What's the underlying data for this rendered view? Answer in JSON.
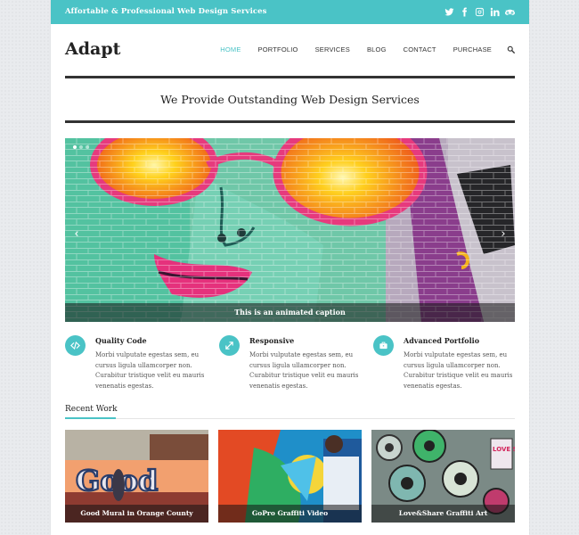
{
  "topbar": {
    "tagline": "Affortable & Professional Web Design Services",
    "social_icons": [
      "twitter-icon",
      "facebook-icon",
      "instagram-icon",
      "linkedin-icon",
      "tripadvisor-icon"
    ]
  },
  "header": {
    "logo": "Adapt",
    "nav": [
      {
        "label": "HOME",
        "active": true
      },
      {
        "label": "PORTFOLIO",
        "active": false
      },
      {
        "label": "SERVICES",
        "active": false
      },
      {
        "label": "BLOG",
        "active": false
      },
      {
        "label": "CONTACT",
        "active": false
      },
      {
        "label": "PURCHASE",
        "active": false
      }
    ],
    "search_icon": "search-icon"
  },
  "headline": "We Provide Outstanding Web Design Services",
  "slider": {
    "caption": "This is an animated caption",
    "prev_icon": "chevron-left-icon",
    "next_icon": "chevron-right-icon",
    "slide_count": 3,
    "active_slide": 1
  },
  "features": [
    {
      "icon": "code-icon",
      "title": "Quality Code",
      "body": "Morbi vulputate egestas sem, eu cursus ligula ullamcorper non. Curabitur tristique velit eu mauris venenatis egestas."
    },
    {
      "icon": "expand-icon",
      "title": "Responsive",
      "body": "Morbi vulputate egestas sem, eu cursus ligula ullamcorper non. Curabitur tristique velit eu mauris venenatis egestas."
    },
    {
      "icon": "briefcase-icon",
      "title": "Advanced Portfolio",
      "body": "Morbi vulputate egestas sem, eu cursus ligula ullamcorper non. Curabitur tristique velit eu mauris venenatis egestas."
    }
  ],
  "recent_work": {
    "title": "Recent Work",
    "items": [
      {
        "caption": "Good Mural in Orange County",
        "mural_text": "Good"
      },
      {
        "caption": "GoPro Graffiti Video"
      },
      {
        "caption": "Love&Share Graffiti Art",
        "mural_text": "LOVE SHARE"
      }
    ]
  },
  "colors": {
    "accent": "#4ac3c6",
    "text_dark": "#222222",
    "page_bg": "#e9ebee"
  }
}
